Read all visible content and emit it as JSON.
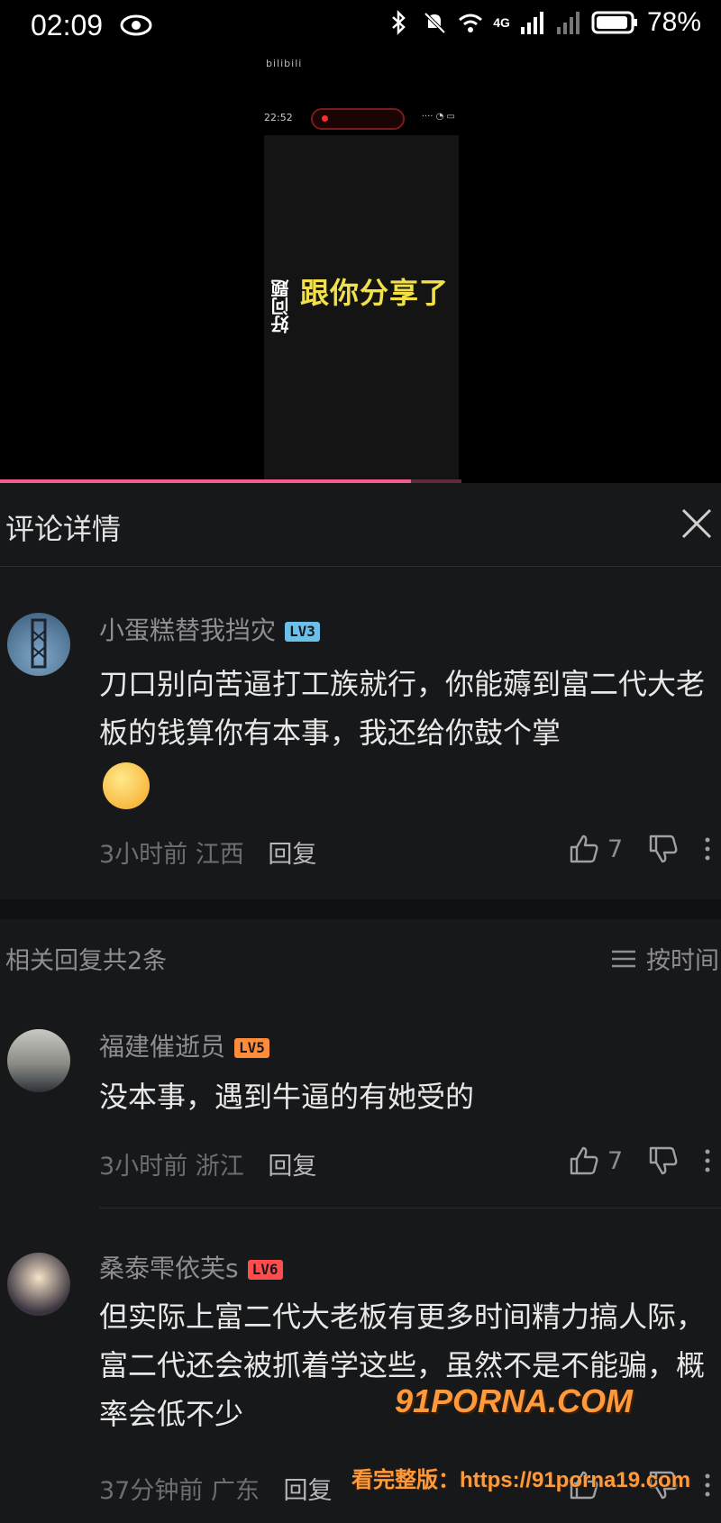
{
  "status_bar": {
    "time": "02:09",
    "battery": "78%",
    "network": "4G"
  },
  "video": {
    "watermark": "bilibili",
    "phone_time": "22:52",
    "vertical_text": "好问题",
    "overlay_text": "跟你分享了",
    "progress": 0.89
  },
  "panel": {
    "title": "评论详情"
  },
  "main_comment": {
    "username": "小蛋糕替我挡灾",
    "level": "LV3",
    "text": "刀口别向苦逼打工族就行，你能薅到富二代大老板的钱算你有本事，我还给你鼓个掌",
    "time": "3小时前",
    "location": "江西",
    "reply_label": "回复",
    "likes": "7"
  },
  "related": {
    "count_label": "相关回复共2条",
    "sort_label": "按时间"
  },
  "replies": [
    {
      "username": "福建催逝员",
      "level": "LV5",
      "text": "没本事，遇到牛逼的有她受的",
      "time": "3小时前",
      "location": "浙江",
      "reply_label": "回复",
      "likes": "7"
    },
    {
      "username": "桑泰雫依芙s",
      "level": "LV6",
      "text": "但实际上富二代大老板有更多时间精力搞人际，富二代还会被抓着学这些，虽然不是不能骗，概率会低不少",
      "time": "37分钟前",
      "location": "广东",
      "reply_label": "回复",
      "likes": ""
    }
  ],
  "overlay_watermark": {
    "brand": "91PORNA.COM",
    "line": "看完整版：https://91porna19.com"
  },
  "colors": {
    "background": "#17181a",
    "accent_pink": "#f25d8e"
  }
}
